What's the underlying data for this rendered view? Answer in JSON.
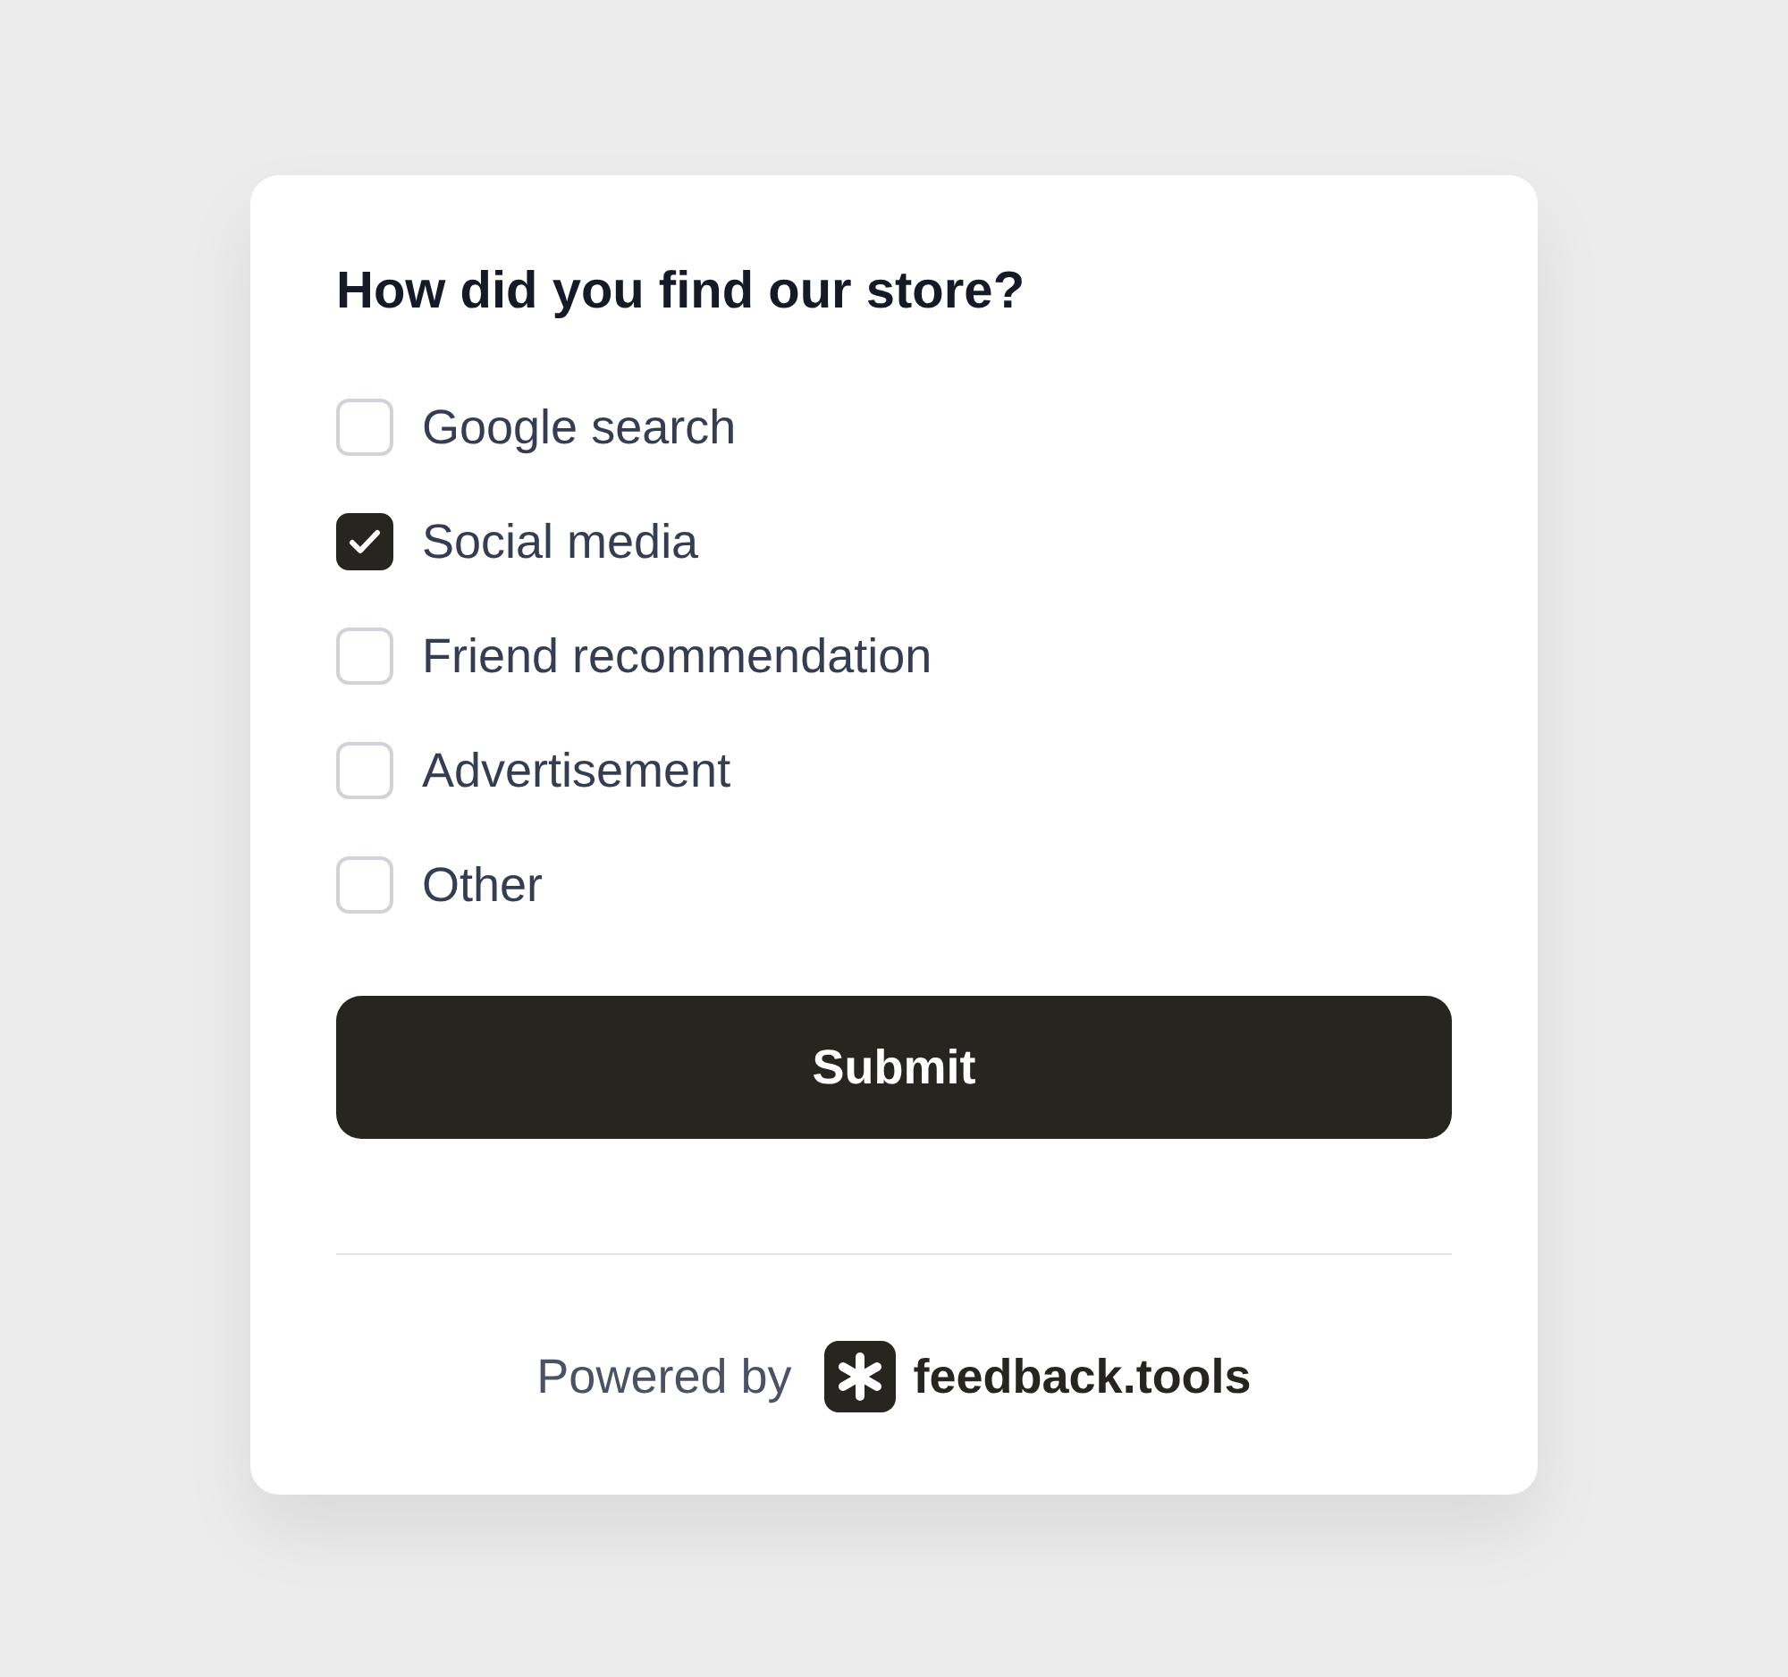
{
  "question": "How did you find our store?",
  "options": [
    {
      "label": "Google search",
      "checked": false
    },
    {
      "label": "Social media",
      "checked": true
    },
    {
      "label": "Friend recommendation",
      "checked": false
    },
    {
      "label": "Advertisement",
      "checked": false
    },
    {
      "label": "Other",
      "checked": false
    }
  ],
  "submit": "Submit",
  "footer": {
    "prefix": "Powered by",
    "brand": "feedback.tools"
  }
}
